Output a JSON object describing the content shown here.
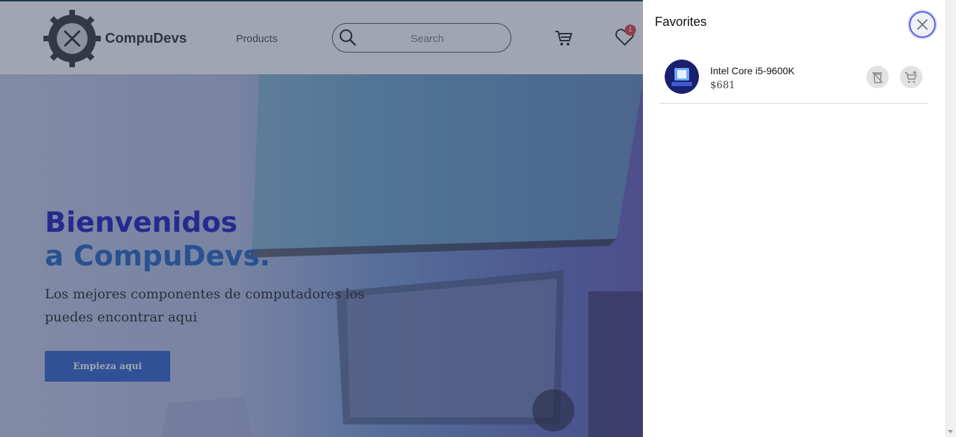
{
  "header": {
    "brand": "CompuDevs",
    "nav_products": "Products",
    "search_placeholder": "Search",
    "favorites_count": "1"
  },
  "hero": {
    "title_line1": "Bienvenidos",
    "title_line2": "a CompuDevs.",
    "subtitle": "Los mejores componentes de computadores los puedes encontrar aqui",
    "cta": "Empieza aqui"
  },
  "favorites": {
    "title": "Favorites",
    "items": [
      {
        "name": "Intel Core i5-9600K",
        "price": "$681"
      }
    ]
  },
  "colors": {
    "accent": "#5b5ee0",
    "hero_title": "#2b2cc4",
    "cta": "#3f6fd2",
    "badge": "#e0505a"
  },
  "icons": [
    "compudevs-logo-icon",
    "search-icon",
    "cart-icon",
    "heart-icon",
    "close-icon",
    "remove-favorite-icon",
    "add-to-cart-icon"
  ]
}
